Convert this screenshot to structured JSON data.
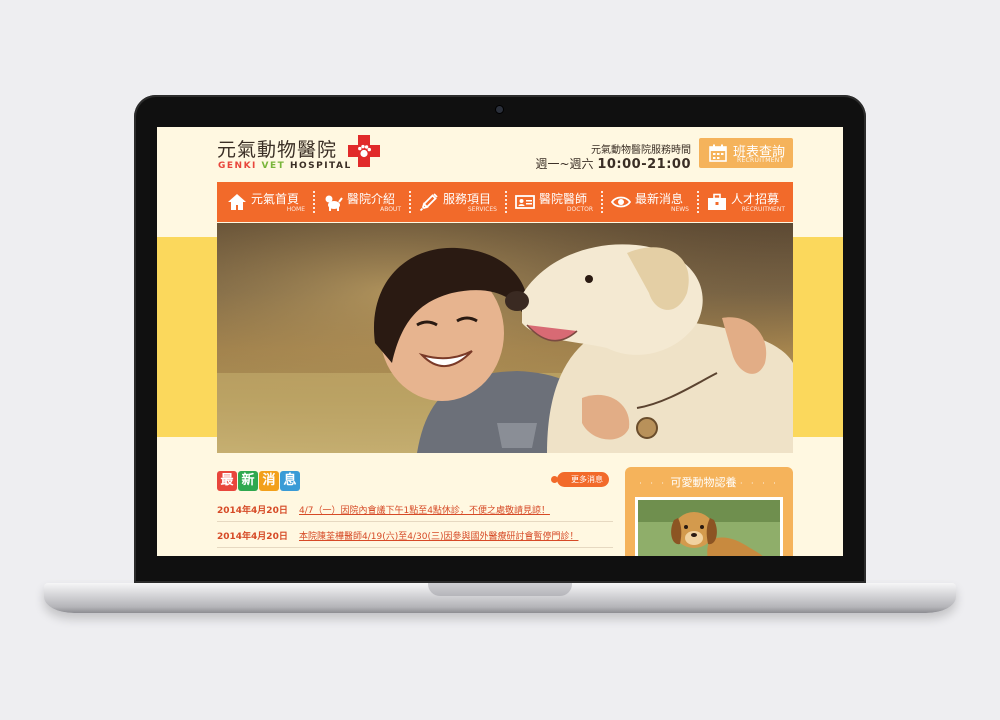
{
  "header": {
    "logo_title": "元氣動物醫院",
    "logo_sub": [
      "GENKI",
      "VET",
      "HOSPITAL"
    ],
    "hours_label": "元氣動物醫院服務時間",
    "hours_days": "週一~週六",
    "hours_time": "10:00-21:00",
    "schedule_label": "班表查詢",
    "schedule_sub": "RECRUITMENT"
  },
  "nav": [
    {
      "label": "元氣首頁",
      "sub": "HOME",
      "icon": "home-icon"
    },
    {
      "label": "醫院介紹",
      "sub": "ABOUT",
      "icon": "dog-icon"
    },
    {
      "label": "服務項目",
      "sub": "SERVICES",
      "icon": "syringe-icon"
    },
    {
      "label": "醫院醫師",
      "sub": "DOCTOR",
      "icon": "id-card-icon"
    },
    {
      "label": "最新消息",
      "sub": "NEWS",
      "icon": "eye-icon"
    },
    {
      "label": "人才招募",
      "sub": "RECRUITMENT",
      "icon": "briefcase-icon"
    }
  ],
  "news": {
    "heading_chars": [
      "最",
      "新",
      "消",
      "息"
    ],
    "heading_colors": [
      "#e8463c",
      "#2fa84f",
      "#f2a01b",
      "#3a9bd6"
    ],
    "more_label": "更多消息",
    "items": [
      {
        "date": "2014年4月20日",
        "title": "4/7（一）因院內會議下午1點至4點休診，不便之處敬請見諒！"
      },
      {
        "date": "2014年4月20日",
        "title": "本院陳荃樺醫師4/19(六)至4/30(三)因參與國外醫療研討會暫停門診！"
      }
    ]
  },
  "adopt": {
    "title": "可愛動物認養"
  },
  "colors": {
    "accent": "#f26a2a",
    "banner_yellow": "#fbd85c",
    "card_orange": "#f5b35b",
    "cream": "#fff8e1"
  }
}
